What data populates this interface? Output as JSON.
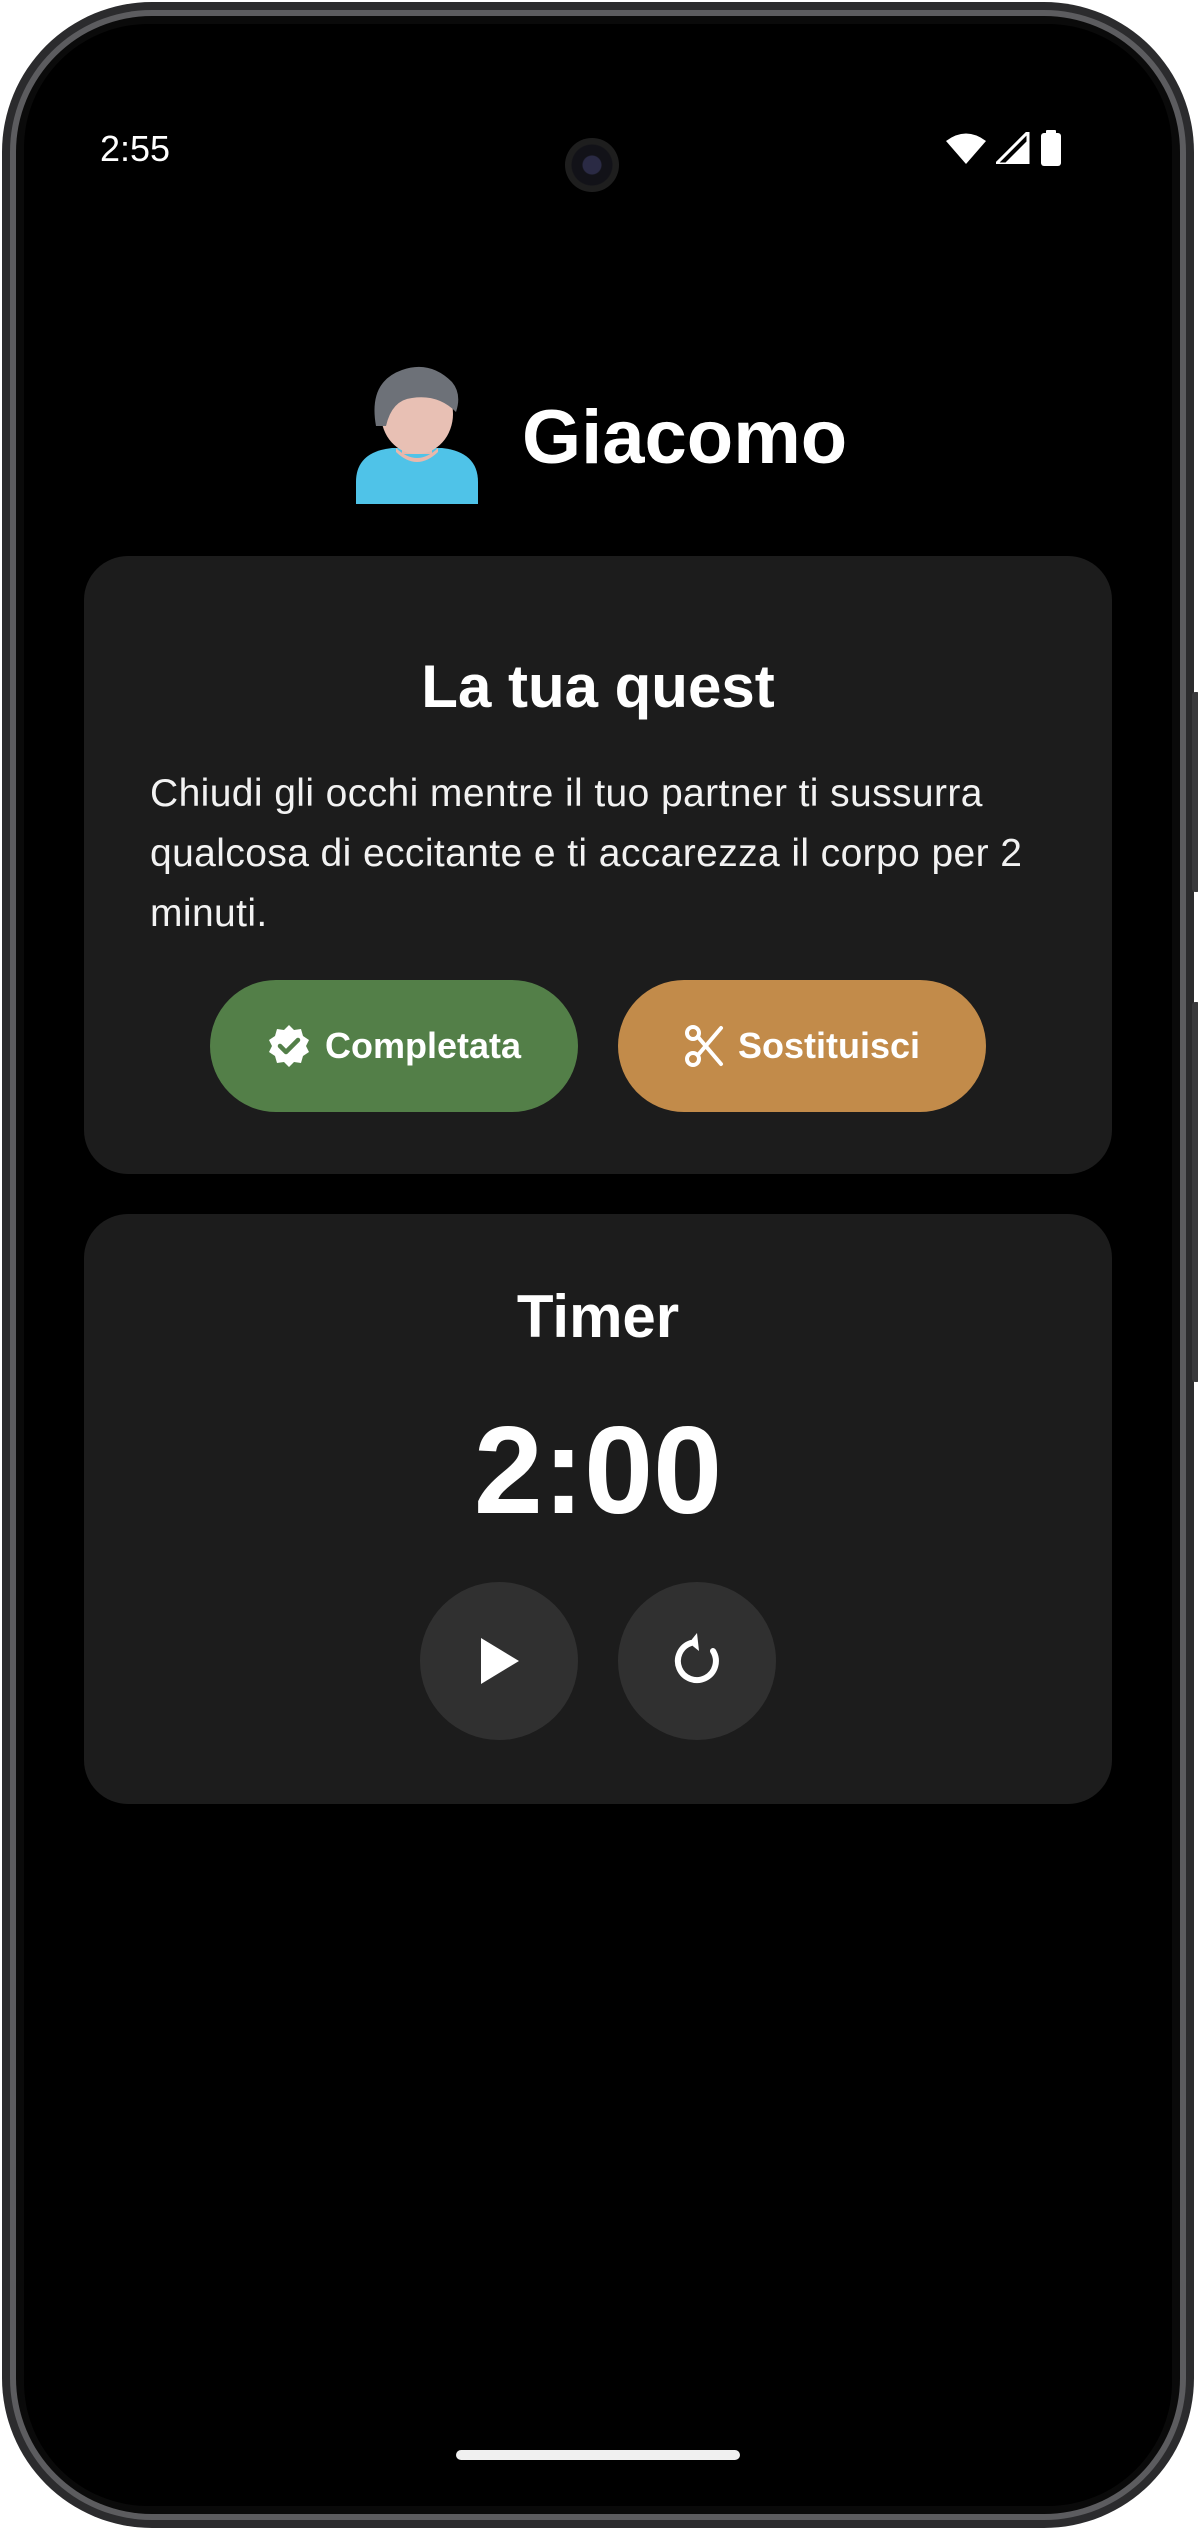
{
  "status_bar": {
    "time": "2:55",
    "icons": [
      "wifi-icon",
      "cellular-signal-icon",
      "battery-icon"
    ]
  },
  "header": {
    "user_name": "Giacomo",
    "avatar_icon": "user-avatar-icon"
  },
  "quest_card": {
    "title": "La tua quest",
    "text": "Chiudi gli occhi mentre il tuo partner ti sussurra qualcosa di eccitante e ti accarezza il corpo per 2 minuti.",
    "complete_button": {
      "label": "Completata",
      "icon": "verified-check-icon",
      "color": "#537f48"
    },
    "replace_button": {
      "label": "Sostituisci",
      "icon": "scissors-icon",
      "color": "#c28b4a"
    }
  },
  "timer_card": {
    "title": "Timer",
    "display": "2:00",
    "play_button_icon": "play-icon",
    "reset_button_icon": "reset-icon"
  },
  "colors": {
    "background": "#000000",
    "card": "#1c1c1c",
    "round_button": "#303030"
  }
}
